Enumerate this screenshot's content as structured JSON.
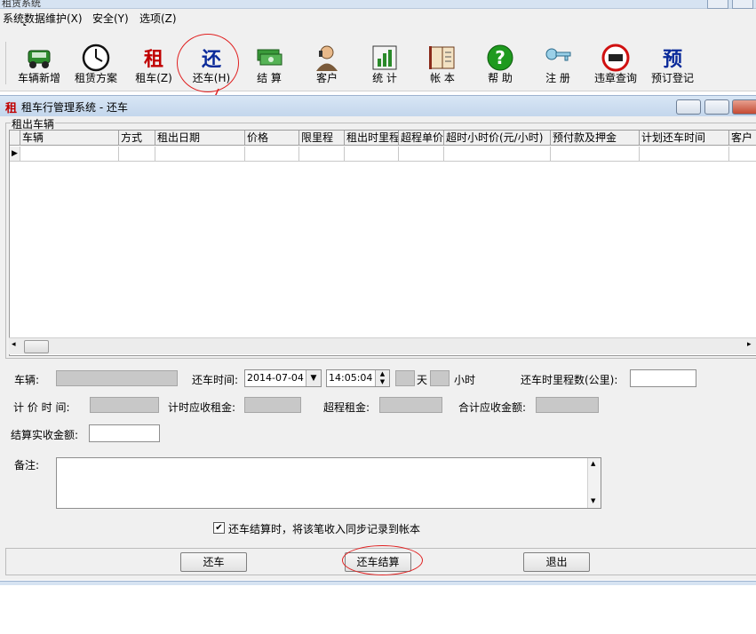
{
  "app": {
    "title": "租赁系统",
    "child_title": "租车行管理系统 - 还车",
    "child_logo": "租"
  },
  "menu": [
    "系统数据维护(X)",
    "安全(Y)",
    "选项(Z)"
  ],
  "toolbar": [
    {
      "label": "车辆新增",
      "icon": "car-icon"
    },
    {
      "label": "租赁方案",
      "icon": "clock-icon"
    },
    {
      "label": "租车(Z)",
      "icon_text": "租",
      "icon": "rent-icon"
    },
    {
      "label": "还车(H)",
      "icon_text": "还",
      "icon": "return-icon"
    },
    {
      "label": "结 算",
      "icon": "money-icon"
    },
    {
      "label": "客户",
      "icon": "customer-icon"
    },
    {
      "label": "统 计",
      "icon": "chart-icon"
    },
    {
      "label": "帐 本",
      "icon": "book-icon"
    },
    {
      "label": "帮 助",
      "icon": "help-icon"
    },
    {
      "label": "注 册",
      "icon": "key-icon"
    },
    {
      "label": "违章查询",
      "icon": "no-entry-icon"
    },
    {
      "label": "预订登记",
      "icon_text": "预",
      "icon": "reserve-icon"
    }
  ],
  "group": {
    "legend": "租出车辆"
  },
  "grid": {
    "columns": [
      "车辆",
      "方式",
      "租出日期",
      "价格",
      "限里程",
      "租出时里程",
      "超程单价",
      "超时小时价(元/小时)",
      "预付款及押金",
      "计划还车时间",
      "客户"
    ]
  },
  "form": {
    "vehicle_label": "车辆:",
    "return_time_label": "还车时间:",
    "return_date": "2014-07-04",
    "return_clock": "14:05:04",
    "day_label": "天",
    "hour_label": "小时",
    "return_mileage_label": "还车时里程数(公里):",
    "billing_time_label": "计 价 时 间:",
    "hourly_rent_label": "计时应收租金:",
    "over_mileage_label": "超程租金:",
    "total_label": "合计应收金额:",
    "actual_label": "结算实收金额:",
    "memo_label": "备注:",
    "sync_check_label": "还车结算时，将该笔收入同步记录到帐本",
    "sync_checked": "✔"
  },
  "buttons": {
    "return": "还车",
    "settle": "还车结算",
    "exit": "退出"
  }
}
